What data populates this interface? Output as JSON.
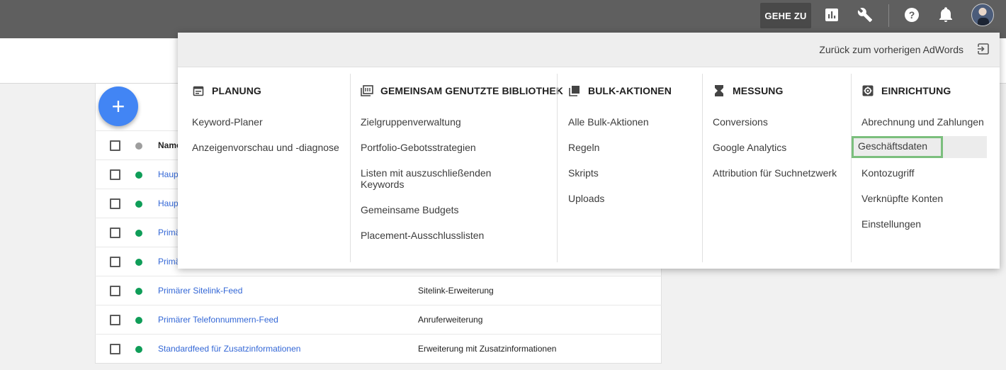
{
  "topbar": {
    "goto_label": "GEHE ZU",
    "icons": [
      "reports-icon",
      "tools-wrench-icon",
      "help-icon",
      "notifications-bell-icon"
    ]
  },
  "menu": {
    "back_label": "Zurück zum vorherigen AdWords",
    "columns": [
      {
        "heading": "PLANUNG",
        "icon": "calendar-icon",
        "items": [
          "Keyword-Planer",
          "Anzeigenvorschau und -diagnose"
        ]
      },
      {
        "heading": "GEMEINSAM GENUTZTE BIBLIOTHEK",
        "icon": "library-icon",
        "items": [
          "Zielgruppenverwaltung",
          "Portfolio-Gebotsstrategien",
          "Listen mit auszuschließenden Keywords",
          "Gemeinsame Budgets",
          "Placement-Ausschlusslisten"
        ]
      },
      {
        "heading": "BULK-AKTIONEN",
        "icon": "bulk-copy-icon",
        "items": [
          "Alle Bulk-Aktionen",
          "Regeln",
          "Skripts",
          "Uploads"
        ]
      },
      {
        "heading": "MESSUNG",
        "icon": "hourglass-icon",
        "items": [
          "Conversions",
          "Google Analytics",
          "Attribution für Suchnetzwerk"
        ]
      },
      {
        "heading": "EINRICHTUNG",
        "icon": "settings-gear-icon",
        "items": [
          "Abrechnung und Zahlungen",
          "Geschäftsdaten",
          "Kontozugriff",
          "Verknüpfte Konten",
          "Einstellungen"
        ],
        "selected_index": 1
      }
    ]
  },
  "table": {
    "header_name": "Name",
    "rows": [
      {
        "name": "Haup",
        "type": ""
      },
      {
        "name": "Haup",
        "type": ""
      },
      {
        "name": "Primä",
        "type": ""
      },
      {
        "name": "Primä",
        "type": ""
      },
      {
        "name": "Primärer Sitelink-Feed",
        "type": "Sitelink-Erweiterung"
      },
      {
        "name": "Primärer Telefonnummern-Feed",
        "type": "Anruferweiterung"
      },
      {
        "name": "Standardfeed für Zusatzinformationen",
        "type": "Erweiterung mit Zusatzinformationen"
      }
    ],
    "add_button": "+"
  }
}
